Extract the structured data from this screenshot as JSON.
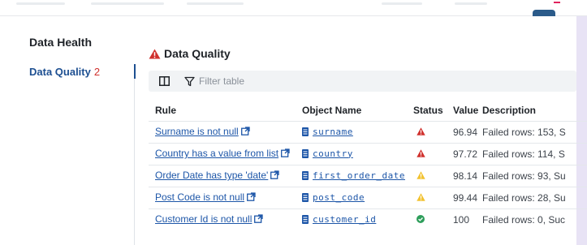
{
  "sidebar": {
    "title": "Data Health",
    "item_label": "Data Quality",
    "item_count": "2"
  },
  "section": {
    "title": "Data Quality"
  },
  "toolbar": {
    "filter_placeholder": "Filter table"
  },
  "table": {
    "headers": {
      "rule": "Rule",
      "object": "Object Name",
      "status": "Status",
      "value": "Value",
      "value_sort": "↑",
      "description": "Description"
    },
    "rows": [
      {
        "rule": "Surname is not null",
        "object": "surname",
        "status": "error",
        "value": "96.94",
        "description": "Failed rows: 153, S"
      },
      {
        "rule": "Country has a value from list",
        "object": "country",
        "status": "error",
        "value": "97.72",
        "description": "Failed rows: 114, S"
      },
      {
        "rule": "Order Date has type 'date'",
        "object": "first_order_date",
        "status": "warning",
        "value": "98.14",
        "description": "Failed rows: 93, Su"
      },
      {
        "rule": "Post Code is not null",
        "object": "post_code",
        "status": "warning",
        "value": "99.44",
        "description": "Failed rows: 28, Su"
      },
      {
        "rule": "Customer Id is not null",
        "object": "customer_id",
        "status": "ok",
        "value": "100",
        "description": "Failed rows: 0, Suc"
      }
    ]
  },
  "colors": {
    "link": "#1d56a8",
    "error": "#d0312d",
    "warning": "#f2c230",
    "ok": "#2e9e5b",
    "accent": "#1d4f91"
  },
  "icons": {
    "external_link": "external-link-icon",
    "object": "document-icon",
    "columns": "columns-icon",
    "filter": "filter-icon"
  }
}
